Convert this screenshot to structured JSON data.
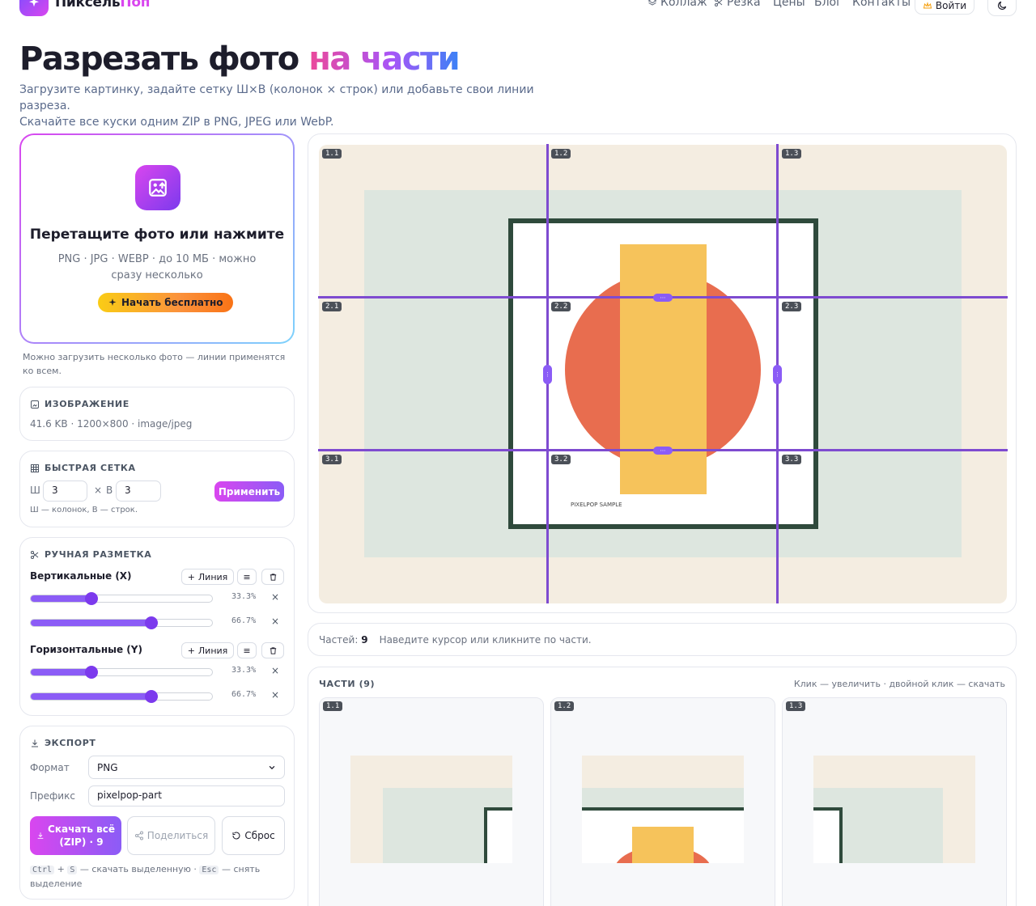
{
  "header": {
    "brand_1": "Пиксель",
    "brand_2": "Поп",
    "nav": [
      {
        "label": "Коллаж",
        "icon": "layers-icon"
      },
      {
        "label": "Резка",
        "icon": "scissors-icon"
      },
      {
        "label": "Цены"
      },
      {
        "label": "Блог"
      },
      {
        "label": "Контакты"
      }
    ],
    "login": "Войти"
  },
  "hero": {
    "title_1": "Разрезать фото",
    "title_2": "на части",
    "subtitle_1": "Загрузите картинку, задайте сетку Ш×В (колонок × строк) или добавьте свои линии разреза.",
    "subtitle_2": "Скачайте все куски одним ZIP в PNG, JPEG или WebP."
  },
  "upload": {
    "title": "Перетащите фото или нажмите",
    "hint": "PNG · JPG · WEBP · до 10 МБ · можно сразу несколько",
    "button": "Начать бесплатно",
    "note": "Можно загрузить несколько фото — линии применятся ко всем."
  },
  "image_info": {
    "heading": "ИЗОБРАЖЕНИЕ",
    "meta": "41.6 KB · 1200×800 · image/jpeg"
  },
  "grid": {
    "heading": "БЫСТРАЯ СЕТКА",
    "w_label": "Ш",
    "w_value": "3",
    "times": "×",
    "h_label": "В",
    "h_value": "3",
    "apply": "Применить",
    "help": "Ш — колонок, В — строк."
  },
  "manual": {
    "heading": "РУЧНАЯ РАЗМЕТКА",
    "vertical_label": "Вертикальные (X)",
    "horizontal_label": "Горизонтальные (Y)",
    "add_line": "Линия",
    "vertical": [
      {
        "value": 33.3,
        "text": "33.3%"
      },
      {
        "value": 66.7,
        "text": "66.7%"
      }
    ],
    "horizontal": [
      {
        "value": 33.3,
        "text": "33.3%"
      },
      {
        "value": 66.7,
        "text": "66.7%"
      }
    ]
  },
  "export": {
    "heading": "ЭКСПОРТ",
    "format_label": "Формат",
    "format_value": "PNG",
    "prefix_label": "Префикс",
    "prefix_value": "pixelpop-part",
    "download": "Скачать всё (ZIP) · 9",
    "share": "Поделиться",
    "reset": "Сброс",
    "kbd_1": "Ctrl",
    "kbd_plus": "+",
    "kbd_2": "S",
    "kbd_note_1": "— скачать выделенную ·",
    "kbd_3": "Esc",
    "kbd_note_2": "— снять выделение"
  },
  "canvas": {
    "sample_text": "PIXELPOP SAMPLE",
    "cells": [
      "1.1",
      "1.2",
      "1.3",
      "2.1",
      "2.2",
      "2.3",
      "3.1",
      "3.2",
      "3.3"
    ],
    "handle": "⋯"
  },
  "status": {
    "count_label": "Частей:",
    "count": "9",
    "hint": "Наведите курсор или кликните по части."
  },
  "parts": {
    "heading": "ЧАСТИ (9)",
    "hint": "Клик — увеличить · двойной клик — скачать",
    "tiles": [
      "1.1",
      "1.2",
      "1.3"
    ]
  },
  "colors": {
    "accent": "#8b5cf6",
    "pink": "#d946ef",
    "cut_line": "#7e4bd0",
    "frame": "#2f4a3c",
    "circle": "#e86d4f",
    "bar": "#f6c35b",
    "mat": "#dde6df",
    "bg": "#f4ede1"
  }
}
